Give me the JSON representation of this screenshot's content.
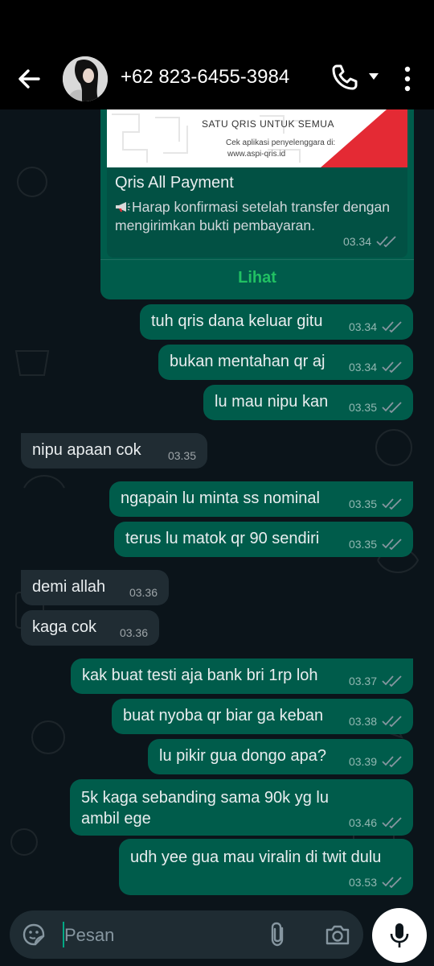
{
  "header": {
    "contact": "+62 823-6455-3984"
  },
  "card": {
    "banner_title": "SATU QRIS UNTUK SEMUA",
    "banner_line1": "Cek aplikasi penyelenggara di:",
    "banner_line2": "www.aspi-qris.id",
    "title": "Qris All Payment",
    "description": "Harap konfirmasi setelah transfer dengan mengirimkan bukti pembayaran.",
    "time": "03.34",
    "link_label": "Lihat"
  },
  "messages": [
    {
      "dir": "out",
      "text": "tuh qris dana keluar gitu",
      "time": "03.34"
    },
    {
      "dir": "out",
      "text": "bukan mentahan qr aj",
      "time": "03.34"
    },
    {
      "dir": "out",
      "text": "lu mau nipu kan",
      "time": "03.35"
    },
    {
      "dir": "in",
      "text": "nipu apaan cok",
      "time": "03.35"
    },
    {
      "dir": "out",
      "text": "ngapain lu minta ss nominal",
      "time": "03.35"
    },
    {
      "dir": "out",
      "text": "terus lu matok qr 90 sendiri",
      "time": "03.35"
    },
    {
      "dir": "in",
      "text": "demi allah",
      "time": "03.36"
    },
    {
      "dir": "in",
      "text": "kaga cok",
      "time": "03.36"
    },
    {
      "dir": "out",
      "text": "kak buat testi aja bank bri 1rp loh",
      "time": "03.37"
    },
    {
      "dir": "out",
      "text": "buat nyoba qr biar ga keban",
      "time": "03.38"
    },
    {
      "dir": "out",
      "text": "lu pikir gua dongo apa?",
      "time": "03.39"
    },
    {
      "dir": "out",
      "text": "5k kaga sebanding sama 90k yg lu ambil ege",
      "time": "03.46"
    },
    {
      "dir": "out",
      "text": "udh yee gua mau viralin di twit dulu",
      "time": "03.53"
    }
  ],
  "composer": {
    "placeholder": "Pesan"
  },
  "colors": {
    "outgoing_bubble": "#005c4b",
    "incoming_bubble": "#202c33",
    "background": "#0b141a",
    "link": "#21c063",
    "read_ticks": "#8696a0"
  }
}
